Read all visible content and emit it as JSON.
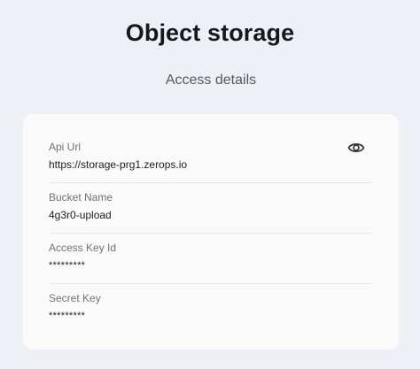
{
  "page": {
    "title": "Object storage",
    "section_title": "Access details"
  },
  "fields": [
    {
      "label": "Api Url",
      "value": "https://storage-prg1.zerops.io"
    },
    {
      "label": "Bucket Name",
      "value": "4g3r0-upload"
    },
    {
      "label": "Access Key Id",
      "value": "*********"
    },
    {
      "label": "Secret Key",
      "value": "*********"
    }
  ],
  "icons": {
    "reveal": "eye-icon"
  },
  "colors": {
    "background": "#edf1f6",
    "card": "#fafafa",
    "title": "#16181c",
    "label": "#6f7279",
    "value": "#1c1e21"
  }
}
